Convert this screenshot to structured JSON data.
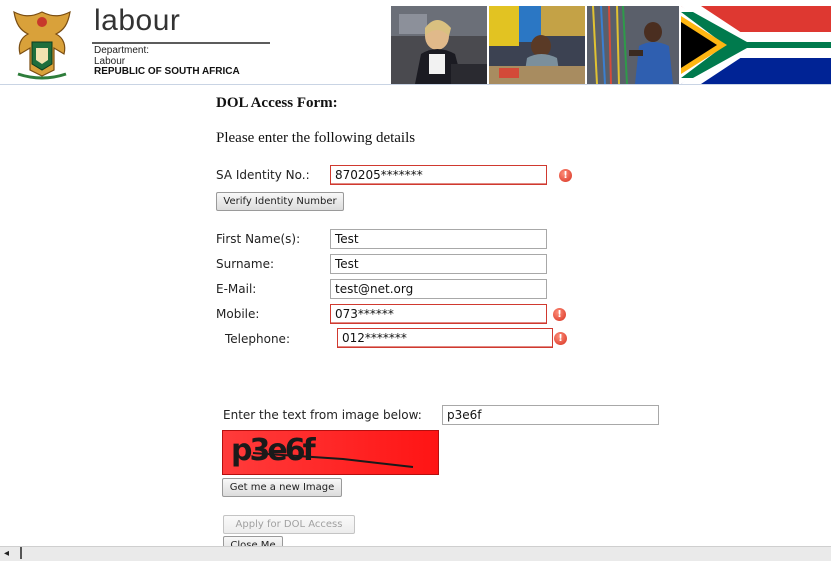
{
  "header": {
    "brand_name": "labour",
    "dept_line1": "Department:",
    "dept_line2": "Labour",
    "dept_line3": "REPUBLIC OF SOUTH AFRICA"
  },
  "form": {
    "title": "DOL Access Form:",
    "subtitle": "Please enter the following details",
    "id_label": "SA Identity No.:",
    "id_value": "870205*******",
    "verify_button": "Verify Identity Number",
    "first_name_label": "First Name(s):",
    "first_name_value": "Test",
    "surname_label": "Surname:",
    "surname_value": "Test",
    "email_label": "E-Mail:",
    "email_value": "test@net.org",
    "mobile_label": "Mobile:",
    "mobile_value": "073******",
    "telephone_label": "Telephone:",
    "telephone_value": "012*******",
    "error_icon": "!",
    "captcha_label": "Enter the text from image below:",
    "captcha_value": "p3e6f",
    "captcha_image_text": "p3e6f",
    "new_image_button": "Get me a new Image",
    "apply_button": "Apply for DOL Access",
    "close_button": "Close Me"
  },
  "colors": {
    "error_border": "#d0392f",
    "captcha_bg": "#ff2020",
    "header_rule": "#c9d4e4"
  }
}
